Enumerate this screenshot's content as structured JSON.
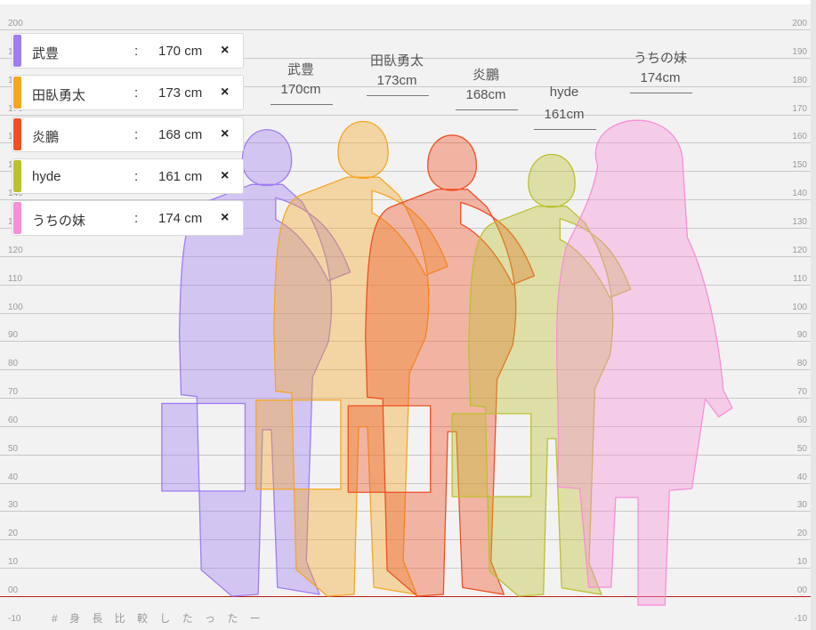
{
  "axis": {
    "ticks": [
      "200",
      "190",
      "180",
      "170",
      "160",
      "150",
      "140",
      "130",
      "120",
      "110",
      "100",
      "90",
      "80",
      "70",
      "60",
      "50",
      "40",
      "30",
      "20",
      "10",
      "00",
      "-10"
    ]
  },
  "people": [
    {
      "name": "武豊",
      "height_label": "170cm",
      "legend_value": "170 cm",
      "height_cm": 170,
      "color": "#a07cf0"
    },
    {
      "name": "田臥勇太",
      "height_label": "173cm",
      "legend_value": "173 cm",
      "height_cm": 173,
      "color": "#f5a623"
    },
    {
      "name": "炎鵬",
      "height_label": "168cm",
      "legend_value": "168 cm",
      "height_cm": 168,
      "color": "#f04f23"
    },
    {
      "name": "hyde",
      "height_label": "161cm",
      "legend_value": "161 cm",
      "height_cm": 161,
      "color": "#bcc02e"
    },
    {
      "name": "うちの妹",
      "height_label": "174cm",
      "legend_value": "174 cm",
      "height_cm": 174,
      "color": "#f78fd8"
    }
  ],
  "legend": {
    "colon": ":",
    "remove_symbol": "×"
  },
  "watermark": "# 身 長 比 較 し た っ た ー"
}
